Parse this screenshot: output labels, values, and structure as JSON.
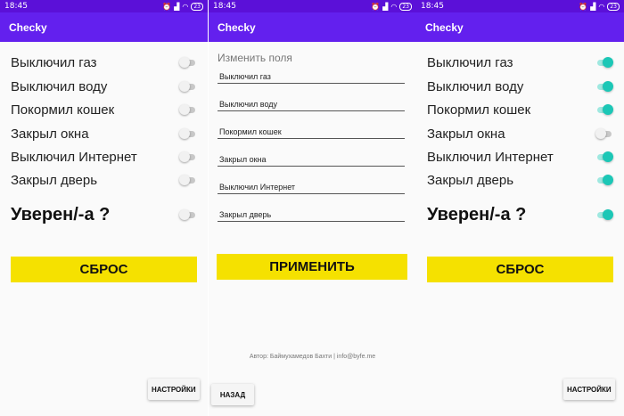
{
  "status": {
    "time": "18:45",
    "battery": "23"
  },
  "app": {
    "title": "Checky"
  },
  "checklist": {
    "items": [
      "Выключил газ",
      "Выключил воду",
      "Покормил кошек",
      "Закрыл окна",
      "Выключил Интернет",
      "Закрыл дверь"
    ],
    "confirm_label": "Уверен/-а ?"
  },
  "screen1": {
    "toggles": [
      false,
      false,
      false,
      false,
      false,
      false
    ],
    "confirm_on": false,
    "reset_label": "СБРОС",
    "settings_label": "НАСТРОЙКИ"
  },
  "screen2": {
    "section_title": "Изменить поля",
    "fields": [
      "Выключил газ",
      "Выключил воду",
      "Покормил кошек",
      "Закрыл окна",
      "Выключил Интернет",
      "Закрыл дверь"
    ],
    "apply_label": "ПРИМЕНИТЬ",
    "author_note": "Автор: Баймухамедов Бахти | info@byfe.me",
    "back_label": "НАЗАД"
  },
  "screen3": {
    "toggles": [
      true,
      true,
      true,
      false,
      true,
      true
    ],
    "confirm_on": true,
    "reset_label": "СБРОС",
    "settings_label": "НАСТРОЙКИ"
  },
  "colors": {
    "status_bar": "#5b10d8",
    "app_bar": "#6320ee",
    "button": "#f5e100",
    "switch_on": "#1cc7b6"
  }
}
